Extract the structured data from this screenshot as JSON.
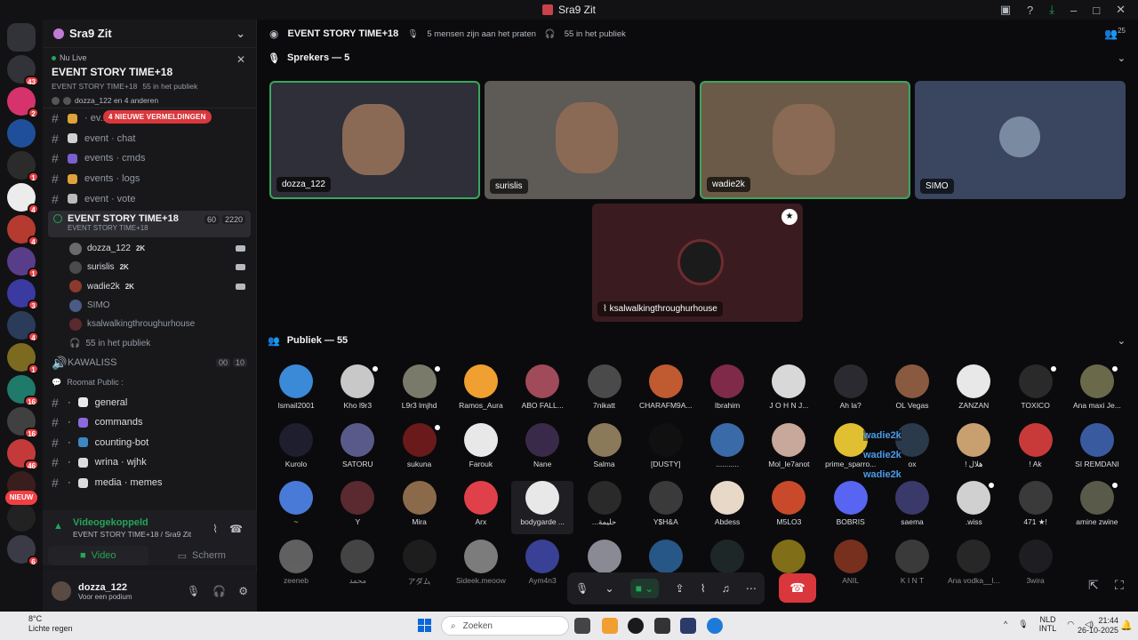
{
  "window": {
    "title": "Sra9 Zit"
  },
  "server": {
    "name": "Sra9 Zit"
  },
  "server_badges": [
    {
      "badge": "43",
      "color": "#313338"
    },
    {
      "badge": "2",
      "color": "#d6336c"
    },
    {
      "badge": "",
      "color": "#1f4f9a"
    },
    {
      "badge": "1",
      "color": "#2b2b2b"
    },
    {
      "badge": "4",
      "color": "#ececec"
    },
    {
      "badge": "4",
      "color": "#b53a2f"
    },
    {
      "badge": "1",
      "color": "#5a3d8a"
    },
    {
      "badge": "3",
      "color": "#3a3aa0"
    },
    {
      "badge": "4",
      "color": "#2b3b5a"
    },
    {
      "badge": "1",
      "color": "#7b6a1f"
    },
    {
      "badge": "16",
      "color": "#1f7a6a"
    },
    {
      "badge": "16",
      "color": "#404040"
    },
    {
      "badge": "46",
      "color": "#c43a3a"
    },
    {
      "badge": "1",
      "color": "#3a1d1d"
    },
    {
      "badge": "",
      "color": "#222"
    },
    {
      "badge": "6",
      "color": "#3b3b48"
    }
  ],
  "new_pill": "NIEUW",
  "live": {
    "status": "Nu Live",
    "title": "EVENT STORY TIME+18",
    "sub_event": "EVENT STORY TIME+18",
    "sub_audience": "55 in het publiek",
    "people": "dozza_122 en 4 anderen"
  },
  "mention_badge": "4 NIEUWE VERMELDINGEN",
  "channels": [
    {
      "label": "· ev...",
      "emoji_color": "#e0a23a"
    },
    {
      "label": "event · chat",
      "emoji_color": "#d0d0d0"
    },
    {
      "label": "events · cmds",
      "emoji_color": "#7a5fd0"
    },
    {
      "label": "events · logs",
      "emoji_color": "#e0a23a"
    },
    {
      "label": "event · vote",
      "emoji_color": "#bbbbbb"
    }
  ],
  "active_voice": {
    "title": "EVENT STORY TIME+18",
    "subtitle": "EVENT STORY TIME+18",
    "video_count": "60",
    "count": "2220"
  },
  "voice_users": [
    {
      "name": "dozza_122",
      "badge": "2K",
      "color": "#6a6a6a",
      "cam": true
    },
    {
      "name": "surislis",
      "badge": "2K",
      "color": "#4b4b4b",
      "cam": true
    },
    {
      "name": "wadie2k",
      "badge": "2K",
      "color": "#8a3b2c",
      "cam": true
    },
    {
      "name": "SIMO",
      "badge": "",
      "color": "#4a5b88",
      "cam": false
    },
    {
      "name": "ksalwalkingthroughurhouse",
      "badge": "",
      "color": "#5a2a2e",
      "cam": false
    }
  ],
  "audience_link": "55 in het publiek",
  "kawaliss": {
    "name": "KAWALISS",
    "c1": "00",
    "c2": "10"
  },
  "category": "Roomat Public :",
  "public_channels": [
    {
      "label": "general",
      "emoji_color": "#e8e8e8"
    },
    {
      "label": "commands",
      "emoji_color": "#8c6adc"
    },
    {
      "label": "counting-bot",
      "emoji_color": "#3b88c3"
    },
    {
      "label": "wrina · wjhk",
      "emoji_color": "#dcdcdc"
    },
    {
      "label": "media · memes",
      "emoji_color": "#dcdcdc"
    }
  ],
  "voice_status": {
    "connected": "Videogekoppeld",
    "location": "EVENT STORY TIME+18 / Sra9 Zit",
    "video_btn": "Video",
    "screen_btn": "Scherm"
  },
  "user": {
    "name": "dozza_122",
    "status": "Voor een podium"
  },
  "stage": {
    "title": "EVENT STORY TIME+18",
    "talking": "5 mensen zijn aan het praten",
    "audience": "55 in het publiek",
    "corner_badge": "25"
  },
  "speakers_header": "Sprekers — 5",
  "speakers": [
    {
      "name": "dozza_122",
      "bg": "#2e2f38",
      "highlight": true
    },
    {
      "name": "surislis",
      "bg": "#5e5a56",
      "highlight": false
    },
    {
      "name": "wadie2k",
      "bg": "#6b5a48",
      "highlight": true
    },
    {
      "name": "SIMO",
      "bg": "#3a4560",
      "highlight": false
    }
  ],
  "featured": {
    "name": "ksalwalkingthroughurhouse"
  },
  "public_header": "Publiek — 55",
  "audience": [
    {
      "name": "Ismail2001",
      "color": "#3a8ad8"
    },
    {
      "name": "Kho l9r3",
      "color": "#c8c8c8"
    },
    {
      "name": "L9r3 lmjhd",
      "color": "#7a7a6a"
    },
    {
      "name": "Ramos_Aura",
      "color": "#f0a030"
    },
    {
      "name": "ABO FALL...",
      "color": "#a04a5a"
    },
    {
      "name": "7nikatt",
      "color": "#4a4a4a"
    },
    {
      "name": "CHARAFM9A...",
      "color": "#c05a30"
    },
    {
      "name": "Ibrahim",
      "color": "#802a4a"
    },
    {
      "name": "J O H N   J...",
      "color": "#d8d8d8"
    },
    {
      "name": "Ah la?",
      "color": "#2a2a30"
    },
    {
      "name": "OL Vegas",
      "color": "#8a5a40"
    },
    {
      "name": "ZANZAN",
      "color": "#e8e8e8"
    },
    {
      "name": "TOXICO",
      "color": "#2a2a2a"
    },
    {
      "name": "Ana maxi Je...",
      "color": "#6a6a4a"
    },
    {
      "name": "Kurolo",
      "color": "#1e1e2e"
    },
    {
      "name": "SATORU",
      "color": "#5a5a8a"
    },
    {
      "name": "sukuna",
      "color": "#6a1a1a"
    },
    {
      "name": "Farouk",
      "color": "#e8e8e8"
    },
    {
      "name": "Nane",
      "color": "#3a2a4a"
    },
    {
      "name": "Salma",
      "color": "#8a7a5a"
    },
    {
      "name": "[DUSTY]",
      "color": "#101010"
    },
    {
      "name": "...........",
      "color": "#3a6aa8"
    },
    {
      "name": "Mol_le7anot",
      "color": "#c8a89a"
    },
    {
      "name": "prime_sparro...",
      "color": "#e0c030"
    },
    {
      "name": "ox",
      "color": "#2a3a4a"
    },
    {
      "name": "! هلال",
      "color": "#c8a070"
    },
    {
      "name": "! Ak",
      "color": "#c83a3a"
    },
    {
      "name": "SI REMDANI",
      "color": "#3a5aa0"
    },
    {
      "name": "~",
      "color": "#4a7ad8"
    },
    {
      "name": "Y",
      "color": "#5a2a30"
    },
    {
      "name": "Mira",
      "color": "#8a6a4a"
    },
    {
      "name": "Arx",
      "color": "#e0404a"
    },
    {
      "name": "bodygarde ...",
      "color": "#e8e8e8"
    },
    {
      "name": "...حليمة",
      "color": "#2a2a2a"
    },
    {
      "name": "Y$H&A",
      "color": "#3a3a3a"
    },
    {
      "name": "Abdess",
      "color": "#e8d8c8"
    },
    {
      "name": "M5LO3",
      "color": "#c84a2a"
    },
    {
      "name": "BOBRIS",
      "color": "#5865f2"
    },
    {
      "name": "saema",
      "color": "#3a3a6a"
    },
    {
      "name": ".wiss",
      "color": "#d0d0d0"
    },
    {
      "name": "471 ★!",
      "color": "#3a3a3a"
    },
    {
      "name": "amine zwine",
      "color": "#5a5a4a"
    },
    {
      "name": "zeeneb",
      "color": "#9a9a9a"
    },
    {
      "name": "محمد",
      "color": "#6a6a6a"
    },
    {
      "name": "アダム",
      "color": "#2a2a2a"
    },
    {
      "name": "Sideek.meoow",
      "color": "#c8c8c8"
    },
    {
      "name": "Aym4n3",
      "color": "#5865f2"
    },
    {
      "name": "",
      "color": "#e0e0f0"
    },
    {
      "name": "",
      "color": "#3a8ad8"
    },
    {
      "name": "",
      "color": "#2a3a3a"
    },
    {
      "name": "",
      "color": "#d0b020"
    },
    {
      "name": "ANIL",
      "color": "#c04a2a"
    },
    {
      "name": "K I N T",
      "color": "#5a5a5a"
    },
    {
      "name": "Ana vodka__l...",
      "color": "#3a3a3a"
    },
    {
      "name": "3wira",
      "color": "#2a2a30"
    }
  ],
  "overlay_names": [
    "wadie2k",
    "wadie2k",
    "wadie2k"
  ],
  "taskbar": {
    "weather_temp": "8°C",
    "weather_text": "Lichte regen",
    "search": "Zoeken",
    "lang1": "NLD",
    "lang2": "INTL",
    "time": "21:44",
    "date": "26-10-2025"
  }
}
